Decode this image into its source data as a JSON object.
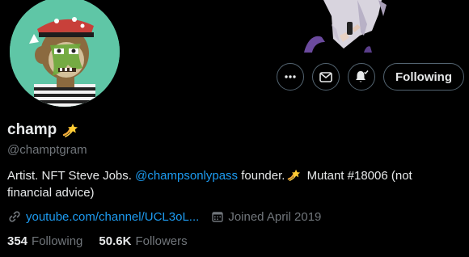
{
  "profile": {
    "display_name": "champ",
    "handle": "@champtgram",
    "bio": {
      "text_1": "Artist. NFT Steve Jobs. ",
      "mention": "@champsonlypass",
      "text_2": " founder.",
      "text_3": " Mutant #18006 (not financial advice)"
    },
    "link": "youtube.com/channel/UCL3oL...",
    "joined": "Joined April 2019"
  },
  "actions": {
    "follow_label": "Following"
  },
  "stats": {
    "following_count": "354",
    "following_label": "Following",
    "followers_count": "50.6K",
    "followers_label": "Followers"
  },
  "icons": {
    "name_badge": "shooting-star-emoji",
    "more": "more-dots-icon",
    "message": "envelope-icon",
    "notify": "bell-check-icon",
    "link": "link-icon",
    "calendar": "calendar-icon"
  },
  "colors": {
    "background": "#000000",
    "text_primary": "#e7e9ea",
    "text_secondary": "#71767b",
    "accent": "#1d9bf0",
    "border": "#536471"
  }
}
